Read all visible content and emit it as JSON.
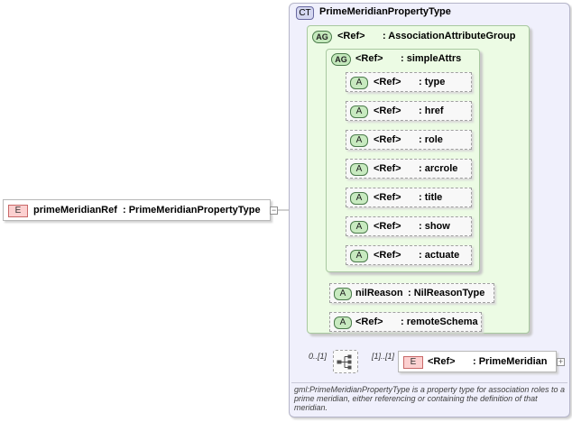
{
  "complex_type": {
    "badge": "CT",
    "title": "PrimeMeridianPropertyType"
  },
  "attribute_group": {
    "badge": "AG",
    "ref": "<Ref>",
    "name": ": AssociationAttributeGroup"
  },
  "simple_attrs_group": {
    "badge": "AG",
    "ref": "<Ref>",
    "name": ": simpleAttrs"
  },
  "simple_attrs": [
    {
      "badge": "A",
      "ref": "<Ref>",
      "name": ": type"
    },
    {
      "badge": "A",
      "ref": "<Ref>",
      "name": ": href"
    },
    {
      "badge": "A",
      "ref": "<Ref>",
      "name": ": role"
    },
    {
      "badge": "A",
      "ref": "<Ref>",
      "name": ": arcrole"
    },
    {
      "badge": "A",
      "ref": "<Ref>",
      "name": ": title"
    },
    {
      "badge": "A",
      "ref": "<Ref>",
      "name": ": show"
    },
    {
      "badge": "A",
      "ref": "<Ref>",
      "name": ": actuate"
    }
  ],
  "nil_reason": {
    "badge": "A",
    "ref": "nilReason",
    "name": ": NilReasonType"
  },
  "remote_schema": {
    "badge": "A",
    "ref": "<Ref>",
    "name": ": remoteSchema"
  },
  "root_element": {
    "badge": "E",
    "name": "primeMeridianRef",
    "type": ": PrimeMeridianPropertyType"
  },
  "sequence": {
    "occurrence": "0..[1]"
  },
  "child_element": {
    "badge": "E",
    "occurrence": "[1]..[1]",
    "ref": "<Ref>",
    "name": ": PrimeMeridian"
  },
  "documentation": "gml:PrimeMeridianPropertyType is a property type for association roles to a prime meridian, either referencing or containing the definition of that meridian.",
  "colors": {
    "element_badge": "#fcd0d0",
    "attribute_badge": "#c8eac0",
    "group_background": "#ecfbe4",
    "type_background": "#f0f0fc"
  }
}
